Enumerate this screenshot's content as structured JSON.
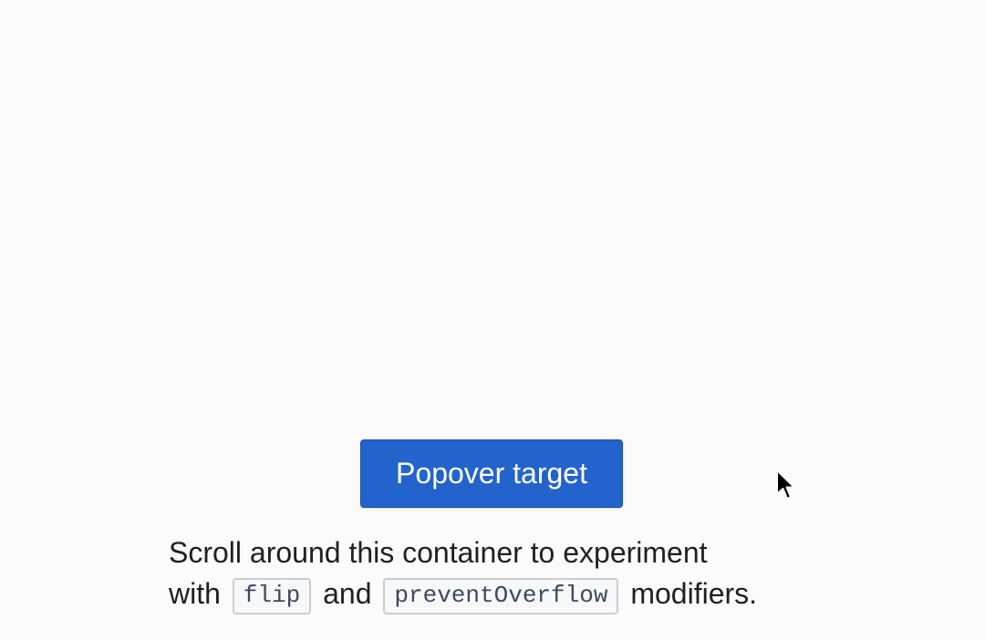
{
  "popover": {
    "button_label": "Popover target"
  },
  "description": {
    "line1": "Scroll around this container to experiment",
    "with_text": "with",
    "flip_code": "flip",
    "and_text": "and",
    "prevent_code": "preventOverflow",
    "tail_text": "modifiers."
  },
  "icons": {
    "cursor": "mouse-pointer-icon"
  },
  "colors": {
    "button_bg": "#2364cc",
    "page_bg": "#fbfbfb",
    "text": "#1f1f24"
  }
}
